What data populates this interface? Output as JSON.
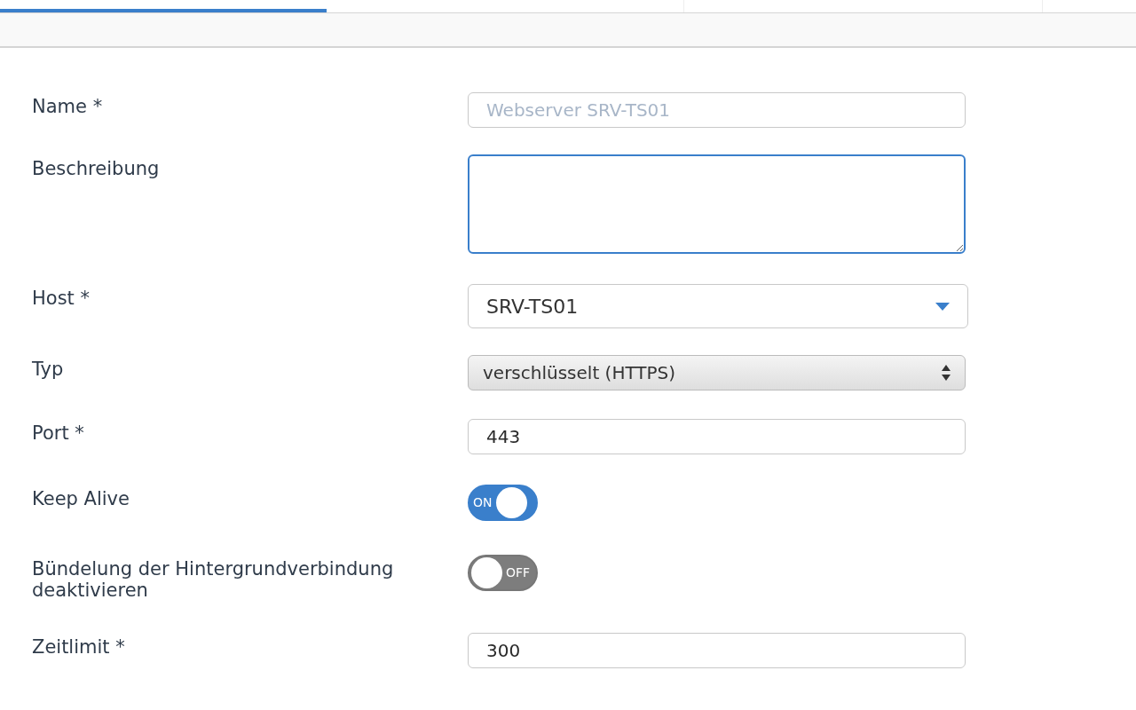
{
  "tabs": [
    {
      "selected": true
    },
    {
      "selected": false
    },
    {
      "selected": false
    }
  ],
  "form": [
    {
      "label": "Name *",
      "kind": "text",
      "placeholder": "Webserver SRV-TS01"
    },
    {
      "label": "Beschreibung",
      "kind": "textarea",
      "focused": true
    },
    {
      "label": "Host *",
      "kind": "combobox",
      "value": "SRV-TS01"
    },
    {
      "label": "Typ",
      "kind": "select",
      "value": "verschlüsselt (HTTPS)"
    },
    {
      "label": "Port *",
      "kind": "text",
      "value": "443"
    },
    {
      "label": "Keep Alive",
      "kind": "toggle",
      "on": true,
      "state_label": "ON"
    },
    {
      "label": "Bündelung der Hintergrundverbindung deaktivieren",
      "kind": "toggle",
      "on": false,
      "state_label": "OFF"
    },
    {
      "label": "Zeitlimit *",
      "kind": "text",
      "value": "300"
    }
  ]
}
